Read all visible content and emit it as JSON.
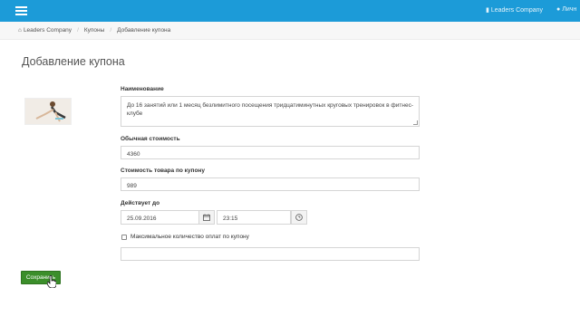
{
  "topbar": {
    "company": "Leaders Company",
    "personal": "Личн"
  },
  "breadcrumb": {
    "home": "Leaders Company",
    "section": "Купоны",
    "current": "Добавление купона"
  },
  "page": {
    "title": "Добавление купона"
  },
  "form": {
    "name_label": "Наименование",
    "name_value": "До 16 занятий или 1 месяц безлимитного посещения тридцатиминутных круговых тренировок в фитнес-клубе",
    "regular_price_label": "Обычная стоимость",
    "regular_price_value": "4360",
    "coupon_price_label": "Стоимость товара по купону",
    "coupon_price_value": "989",
    "valid_until_label": "Действует до",
    "date_value": "25.09.2016",
    "time_value": "23:15",
    "max_payments_label": "Максимальное количество оплат по купону",
    "max_payments_value": "",
    "max_payments_checked": false
  },
  "actions": {
    "save_label": "Сохранить"
  },
  "colors": {
    "topbar": "#1c9bd8",
    "save_button": "#3b8e2a"
  },
  "icons": {
    "menu": "hamburger-icon",
    "home": "home-icon",
    "user": "user-icon",
    "calendar": "calendar-icon",
    "clock": "clock-icon",
    "cursor": "hand-cursor-icon"
  }
}
